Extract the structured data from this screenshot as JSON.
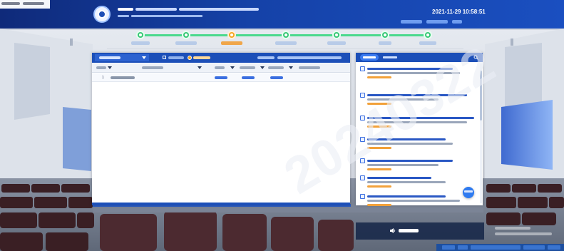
{
  "header": {
    "project_line1": "",
    "project_line2": "",
    "datetime": "2021-11-29  10:58:51"
  },
  "steps": [
    {
      "label": "",
      "state": "done"
    },
    {
      "label": "",
      "state": "done"
    },
    {
      "label": "",
      "state": "current"
    },
    {
      "label": "",
      "state": "todo"
    },
    {
      "label": "",
      "state": "todo"
    },
    {
      "label": "",
      "state": "todo"
    },
    {
      "label": "",
      "state": "todo"
    }
  ],
  "left_panel": {
    "dropdown_label": "",
    "header_note": "",
    "columns": [
      "",
      "",
      "",
      "",
      "",
      "",
      ""
    ],
    "rows": [
      {
        "index": "1",
        "name": "",
        "c1": "",
        "c2": "",
        "c3": ""
      }
    ]
  },
  "right_panel": {
    "tab_active": "",
    "tab_idle": "",
    "messages": [
      {
        "title": "",
        "body": "",
        "time": ""
      },
      {
        "title": "",
        "body": "",
        "time": ""
      },
      {
        "title": "",
        "body": "",
        "time": ""
      },
      {
        "title": "",
        "body": "",
        "time": ""
      },
      {
        "title": "",
        "body": "",
        "time": ""
      },
      {
        "title": "",
        "body": "",
        "time": ""
      },
      {
        "title": "",
        "body": "",
        "time": ""
      }
    ]
  },
  "bottom": {
    "button_label": ""
  },
  "watermark": "20240322",
  "colors": {
    "primary": "#1c4fb8",
    "header_dark": "#0f2a7a",
    "step_done": "#38c777",
    "step_current": "#f5a623",
    "link": "#3a6ee0",
    "time": "#f2a13a"
  }
}
